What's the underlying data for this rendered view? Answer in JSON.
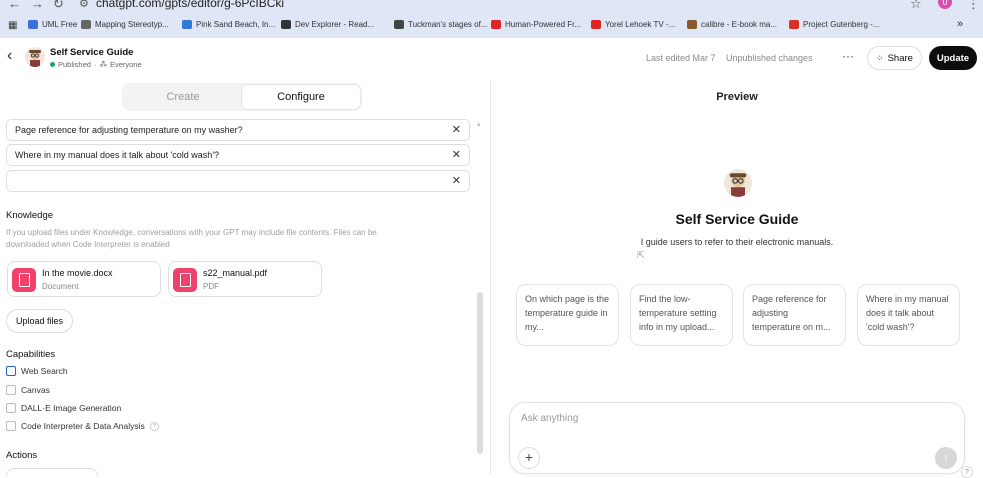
{
  "browser": {
    "url": "chatgpt.com/gpts/editor/g-6PcIBCki",
    "bookmarks": [
      {
        "label": "UML Free",
        "color": "#3b6ed6"
      },
      {
        "label": "Mapping Stereotyp...",
        "color": "#666666"
      },
      {
        "label": "Pink Sand Beach, In...",
        "color": "#2f7ad8"
      },
      {
        "label": "Dev Explorer - Read...",
        "color": "#333333"
      },
      {
        "label": "Tuckman's stages of...",
        "color": "#444444"
      },
      {
        "label": "Human-Powered Fr...",
        "color": "#e02424"
      },
      {
        "label": "Yorel Lehoek TV -...",
        "color": "#e02424"
      },
      {
        "label": "calibre - E-book ma...",
        "color": "#8b5a2b"
      },
      {
        "label": "Project Gutenberg -...",
        "color": "#d93025"
      }
    ]
  },
  "header": {
    "title": "Self Service Guide",
    "status": "Published",
    "audience": "Everyone",
    "last_edited": "Last edited Mar 7",
    "unpublished": "Unpublished changes",
    "share_label": "Share",
    "update_label": "Update"
  },
  "tabs": {
    "create": "Create",
    "configure": "Configure"
  },
  "starters": [
    "Page reference for adjusting temperature on my washer?",
    "Where in my manual does it talk about 'cold wash'?",
    ""
  ],
  "knowledge": {
    "title": "Knowledge",
    "description_line1": "If you upload files under Knowledge, conversations with your GPT may include file contents. Files can be",
    "description_line2": "downloaded when Code Interpreter is enabled",
    "files": [
      {
        "name": "In the movie.docx",
        "type": "Document"
      },
      {
        "name": "s22_manual.pdf",
        "type": "PDF"
      }
    ],
    "upload_label": "Upload files"
  },
  "capabilities": {
    "title": "Capabilities",
    "items": [
      {
        "label": "Web Search",
        "checked": false
      },
      {
        "label": "Canvas",
        "checked": false
      },
      {
        "label": "DALL·E Image Generation",
        "checked": false
      },
      {
        "label": "Code Interpreter & Data Analysis",
        "checked": false
      }
    ]
  },
  "actions": {
    "title": "Actions"
  },
  "preview": {
    "label": "Preview",
    "name": "Self Service Guide",
    "description": "I guide users to refer to their electronic manuals.",
    "suggestions": [
      "On which page is the temperature guide in my...",
      "Find the low-temperature setting info in my upload...",
      "Page reference for adjusting temperature on m...",
      "Where in my manual does it talk about 'cold wash'?"
    ],
    "input_placeholder": "Ask anything"
  }
}
